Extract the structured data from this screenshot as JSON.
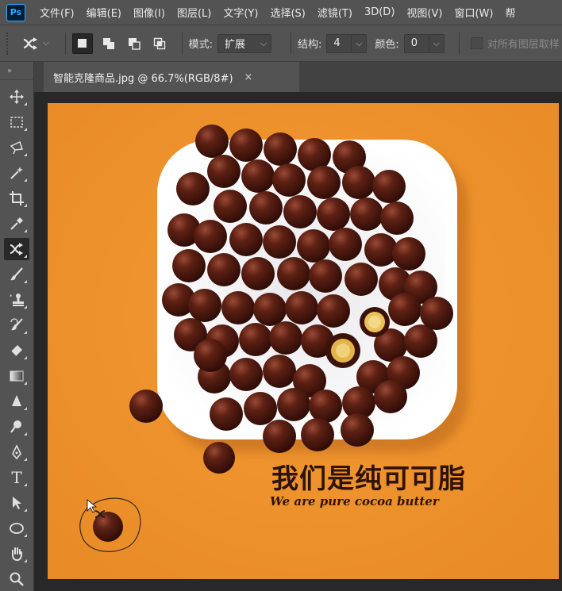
{
  "app": {
    "logo": "Ps"
  },
  "menu": [
    "文件(F)",
    "编辑(E)",
    "图像(I)",
    "图层(L)",
    "文字(Y)",
    "选择(S)",
    "滤镜(T)",
    "3D(D)",
    "视图(V)",
    "窗口(W)",
    "帮"
  ],
  "options": {
    "mode_label": "模式:",
    "mode_value": "扩展",
    "structure_label": "结构:",
    "structure_value": "4",
    "color_label": "颜色:",
    "color_value": "0",
    "sample_all_label": "对所有图层取样"
  },
  "toolbar": {
    "collapse": "»",
    "tools": [
      "move-icon",
      "marquee-icon",
      "lasso-icon",
      "magic-wand-icon",
      "crop-icon",
      "eyedropper-icon",
      "content-aware-move-icon",
      "brush-icon",
      "clone-stamp-icon",
      "history-brush-icon",
      "eraser-icon",
      "gradient-icon",
      "blur-icon",
      "dodge-icon",
      "pen-icon",
      "type-icon",
      "path-select-icon",
      "ellipse-icon",
      "hand-icon",
      "zoom-icon"
    ],
    "type_tool_glyph": "T"
  },
  "document": {
    "tab_title": "智能克隆商品.jpg @ 66.7%(RGB/8#)",
    "close": "×"
  },
  "artwork": {
    "headline": "我们是纯可可脂",
    "subline": "We are pure cocoa butter"
  },
  "colors": {
    "background": "#f0952f",
    "plate": "#ffffff",
    "chocolate": "#4a1a10",
    "ui_dark": "#282828",
    "ui_panel": "#535353"
  }
}
